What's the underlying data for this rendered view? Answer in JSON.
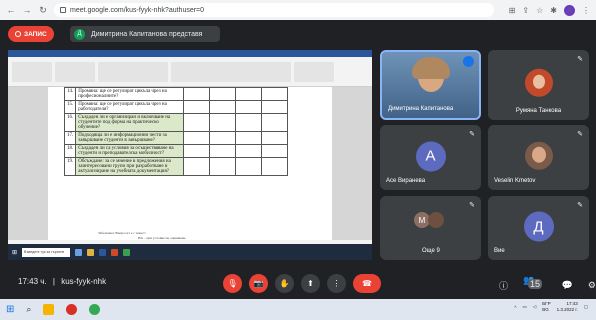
{
  "browser": {
    "url": "meet.google.com/kus-fyyk-nhk?authuser=0",
    "profile_initial": "A"
  },
  "meeting": {
    "recording_label": "ЗАПИС",
    "presenter_initial": "Д",
    "presenter_label": "Димитрина Капитанова представя",
    "time": "17:43 ч.",
    "code": "kus-fyyk-nhk",
    "participants_count": "15"
  },
  "document": {
    "rows": [
      {
        "num": "14.",
        "text": "Промяна: ще се регулират цикъла чрез на професионалните?",
        "green": false
      },
      {
        "num": "15.",
        "text": "Промяна: ще се регулират цикъла чрез на работодателя?",
        "green": false
      },
      {
        "num": "16.",
        "text": "Създаден ли е организиран и включване на студентите под форма на практическо обучение?",
        "green": true
      },
      {
        "num": "17.",
        "text": "Подходяща ли е информационни чести за завършване студенти в завършване?",
        "green": true
      },
      {
        "num": "18.",
        "text": "Създаден ли са условия за осъществяване на студенти и преподавателска мобилност?",
        "green": true
      },
      {
        "num": "19.",
        "text": "Обсъждане: за се мнение в предложения на заинтересовани групи при разработване и актуализиране на учебната документация?",
        "green": true
      }
    ],
    "note1": "Забележка: Въпросът е с тежест",
    "note2": "НА – при условие на оценяване,",
    "note3": "НП – при условие на неприложимо",
    "search_placeholder": "Въведете тук за търсене"
  },
  "tiles": [
    {
      "name": "Димитрина Капитанова",
      "type": "speaker"
    },
    {
      "name": "Румяна Танкова",
      "type": "photo"
    },
    {
      "name": "Асе Виранева",
      "initial": "А",
      "color": "#5c6bc0"
    },
    {
      "name": "Veselin Kmetov",
      "type": "photo"
    },
    {
      "name": "Още 9",
      "initial": "М",
      "color": "#8d6e63"
    },
    {
      "name": "Вие",
      "initial": "Д",
      "color": "#5c6bc0"
    }
  ],
  "tray": {
    "lang": "БГР",
    "lang2": "BG",
    "clock_time": "17:43",
    "clock_date": "1.3.2022 г."
  },
  "colors": {
    "accent_red": "#ea4335",
    "tile_bg": "#3c4043",
    "background": "#202124"
  }
}
